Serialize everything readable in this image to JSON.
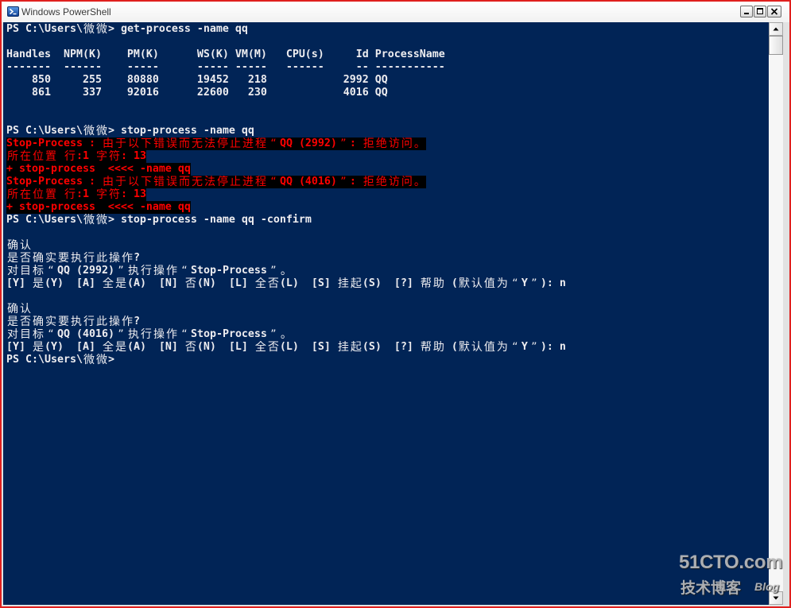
{
  "window": {
    "title": "Windows PowerShell",
    "icon": "powershell-icon",
    "buttons": {
      "minimize": "minimize-icon",
      "maximize": "maximize-icon",
      "close": "close-icon"
    }
  },
  "colors": {
    "console_background": "#012456",
    "console_foreground": "#EEEDF0",
    "error_foreground": "#FF0000",
    "error_background": "#000000",
    "outline": "#E0201E"
  },
  "console": {
    "lines": [
      {
        "text": "PS C:\\Users\\微微> get-process -name qq"
      },
      {
        "text": ""
      },
      {
        "text": "Handles  NPM(K)    PM(K)      WS(K) VM(M)   CPU(s)     Id ProcessName"
      },
      {
        "text": "-------  ------    -----      ----- -----   ------     -- -----------"
      },
      {
        "text": "    850     255    80880      19452   218            2992 QQ"
      },
      {
        "text": "    861     337    92016      22600   230            4016 QQ"
      },
      {
        "text": ""
      },
      {
        "text": ""
      },
      {
        "text": "PS C:\\Users\\微微> stop-process -name qq"
      },
      {
        "text": "Stop-Process : 由于以下错误而无法停止进程“QQ (2992)”: 拒绝访问。",
        "error": true
      },
      {
        "text": "所在位置 行:1 字符: 13",
        "error": true
      },
      {
        "text": "+ stop-process  <<<< -name qq",
        "error": true
      },
      {
        "text": "Stop-Process : 由于以下错误而无法停止进程“QQ (4016)”: 拒绝访问。",
        "error": true
      },
      {
        "text": "所在位置 行:1 字符: 13",
        "error": true
      },
      {
        "text": "+ stop-process  <<<< -name qq",
        "error": true
      },
      {
        "text": "PS C:\\Users\\微微> stop-process -name qq -confirm"
      },
      {
        "text": ""
      },
      {
        "text": "确认"
      },
      {
        "text": "是否确实要执行此操作?"
      },
      {
        "text": "对目标“QQ (2992)”执行操作“Stop-Process”。"
      },
      {
        "text": "[Y] 是(Y)  [A] 全是(A)  [N] 否(N)  [L] 全否(L)  [S] 挂起(S)  [?] 帮助 (默认值为“Y”): n"
      },
      {
        "text": ""
      },
      {
        "text": "确认"
      },
      {
        "text": "是否确实要执行此操作?"
      },
      {
        "text": "对目标“QQ (4016)”执行操作“Stop-Process”。"
      },
      {
        "text": "[Y] 是(Y)  [A] 全是(A)  [N] 否(N)  [L] 全否(L)  [S] 挂起(S)  [?] 帮助 (默认值为“Y”): n"
      },
      {
        "text": "PS C:\\Users\\微微>"
      }
    ]
  },
  "scrollbar": {
    "scroll_fraction": 0,
    "up_icon": "arrow-up-icon",
    "down_icon": "arrow-down-icon"
  },
  "watermark": {
    "brand": "51CTO.com",
    "tagline": "技术博客",
    "label": "Blog"
  }
}
